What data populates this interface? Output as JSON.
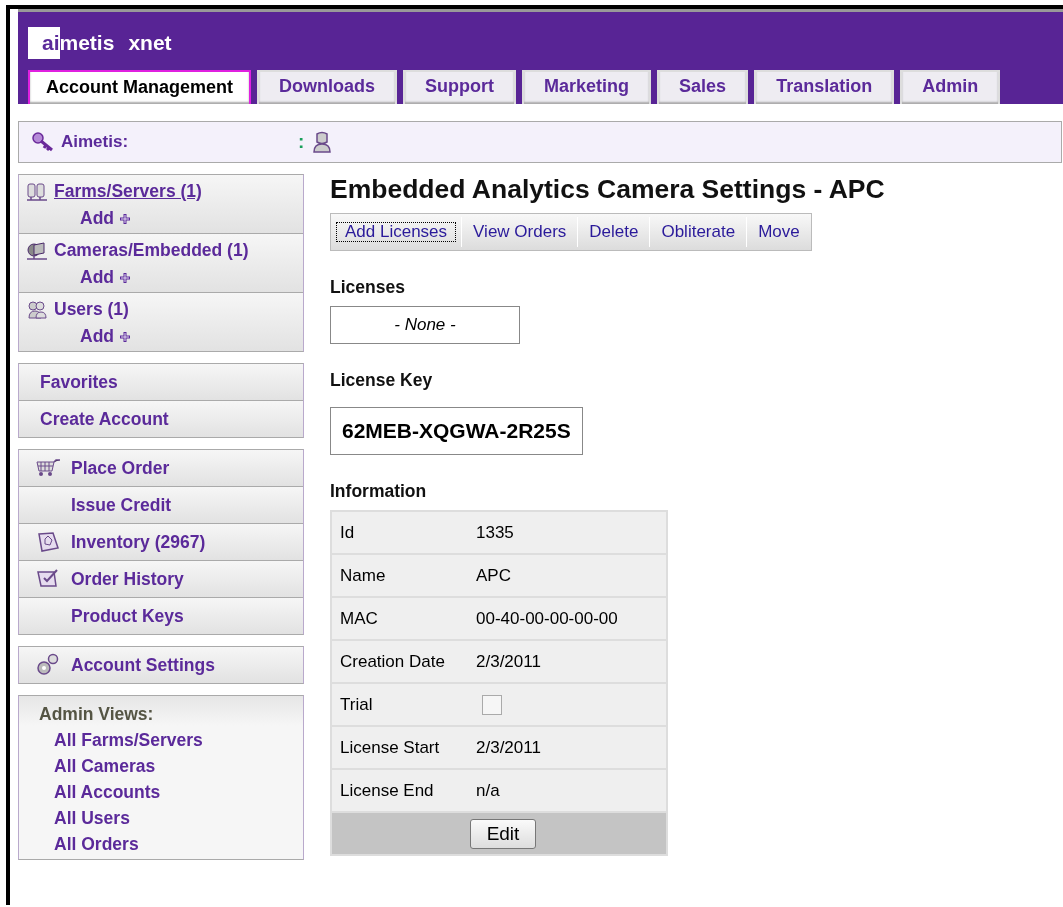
{
  "header": {
    "logo": {
      "highlighted": "ai",
      "rest": "metis"
    },
    "product": "xnet"
  },
  "tabs": [
    {
      "label": "Account Management",
      "selected": true
    },
    {
      "label": "Downloads",
      "selected": false
    },
    {
      "label": "Support",
      "selected": false
    },
    {
      "label": "Marketing",
      "selected": false
    },
    {
      "label": "Sales",
      "selected": false
    },
    {
      "label": "Translation",
      "selected": false
    },
    {
      "label": "Admin",
      "selected": false
    }
  ],
  "account_bar": {
    "label": "Aimetis:",
    "separator": ":"
  },
  "sidebar": {
    "sections": [
      {
        "kind": "entities",
        "items": [
          {
            "label": "Farms/Servers (1)",
            "hovered": true,
            "add": "Add"
          },
          {
            "label": "Cameras/Embedded (1)",
            "hovered": false,
            "add": "Add"
          },
          {
            "label": "Users (1)",
            "hovered": false,
            "add": "Add"
          }
        ]
      },
      {
        "kind": "links",
        "items": [
          {
            "label": "Favorites"
          },
          {
            "label": "Create Account"
          }
        ]
      },
      {
        "kind": "icon_links",
        "items": [
          {
            "label": "Place Order"
          },
          {
            "label": "Issue Credit"
          },
          {
            "label": "Inventory (2967)"
          },
          {
            "label": "Order History"
          },
          {
            "label": "Product Keys"
          }
        ]
      },
      {
        "kind": "icon_links",
        "items": [
          {
            "label": "Account Settings"
          }
        ]
      },
      {
        "kind": "admin",
        "heading": "Admin Views:",
        "items": [
          {
            "label": "All Farms/Servers"
          },
          {
            "label": "All Cameras"
          },
          {
            "label": "All Accounts"
          },
          {
            "label": "All Users"
          },
          {
            "label": "All Orders"
          }
        ]
      }
    ]
  },
  "main": {
    "title": "Embedded Analytics Camera Settings - APC",
    "actions": [
      {
        "label": "Add Licenses",
        "focused": true
      },
      {
        "label": "View Orders",
        "focused": false
      },
      {
        "label": "Delete",
        "focused": false
      },
      {
        "label": "Obliterate",
        "focused": false
      },
      {
        "label": "Move",
        "focused": false
      }
    ],
    "licenses": {
      "heading": "Licenses",
      "empty_text": "- None -"
    },
    "license_key": {
      "heading": "License Key",
      "value": "62MEB-XQGWA-2R25S"
    },
    "information": {
      "heading": "Information",
      "rows": [
        {
          "kind": "text",
          "label": "Id",
          "value": "1335"
        },
        {
          "kind": "text",
          "label": "Name",
          "value": "APC"
        },
        {
          "kind": "text",
          "label": "MAC",
          "value": "00-40-00-00-00-00"
        },
        {
          "kind": "text",
          "label": "Creation Date",
          "value": "2/3/2011"
        },
        {
          "kind": "checkbox",
          "label": "Trial",
          "checked": false
        },
        {
          "kind": "text",
          "label": "License Start",
          "value": "2/3/2011"
        },
        {
          "kind": "text",
          "label": "License End",
          "value": "n/a"
        }
      ],
      "button": "Edit"
    }
  }
}
